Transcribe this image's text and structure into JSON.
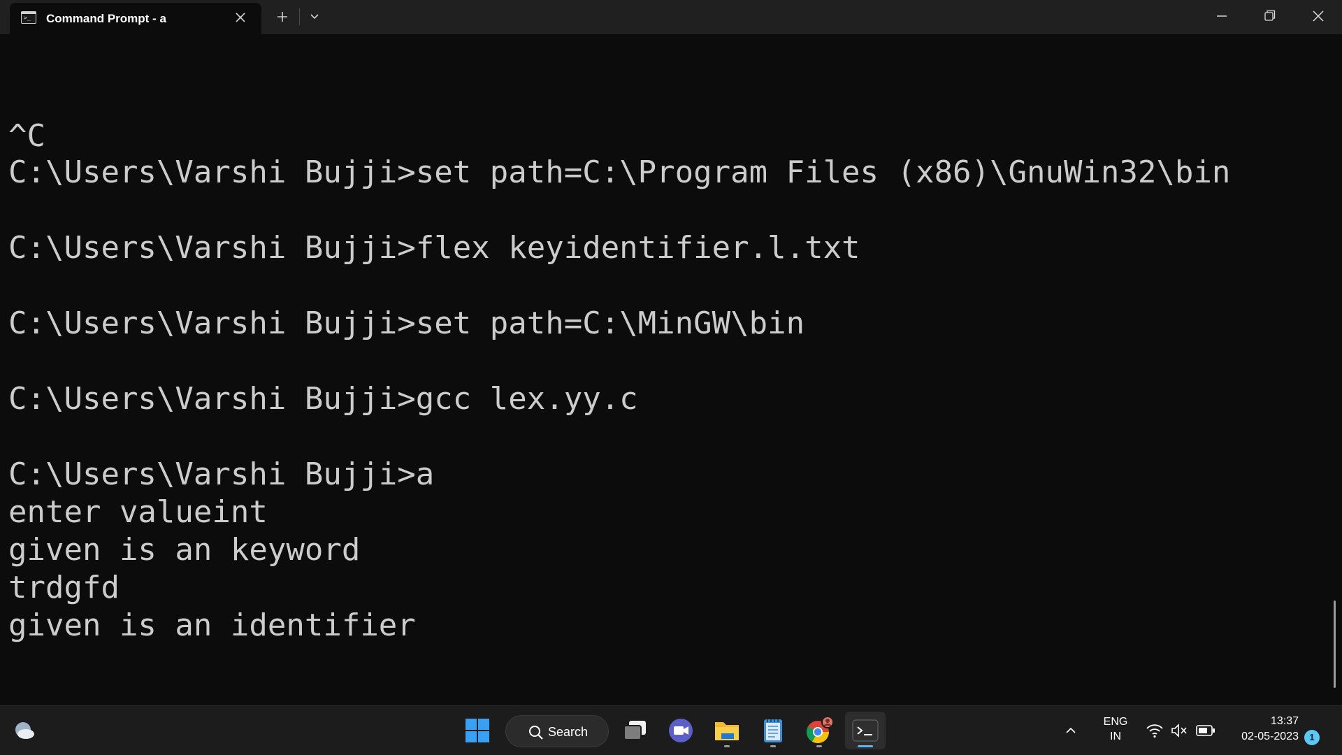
{
  "window": {
    "tab_title": "Command Prompt - a",
    "tab_icon": "terminal-icon",
    "buttons": [
      "new-tab",
      "dropdown",
      "minimize",
      "maximize",
      "close"
    ]
  },
  "terminal": {
    "lines": [
      "^C",
      "C:\\Users\\Varshi Bujji>set path=C:\\Program Files (x86)\\GnuWin32\\bin",
      "",
      "C:\\Users\\Varshi Bujji>flex keyidentifier.l.txt",
      "",
      "C:\\Users\\Varshi Bujji>set path=C:\\MinGW\\bin",
      "",
      "C:\\Users\\Varshi Bujji>gcc lex.yy.c",
      "",
      "C:\\Users\\Varshi Bujji>a",
      "enter valueint",
      "given is an keyword",
      "trdgfd",
      "given is an identifier"
    ],
    "text_color": "#cccccc",
    "background": "#0c0c0c"
  },
  "taskbar": {
    "search_label": "Search",
    "apps": [
      "start",
      "search",
      "task-view",
      "teams-meet",
      "file-explorer",
      "notepad",
      "chrome",
      "terminal"
    ],
    "tray": {
      "language_line1": "ENG",
      "language_line2": "IN",
      "time": "13:37",
      "date": "02-05-2023",
      "notification_count": "1"
    },
    "accent": "#5cb4f0"
  }
}
